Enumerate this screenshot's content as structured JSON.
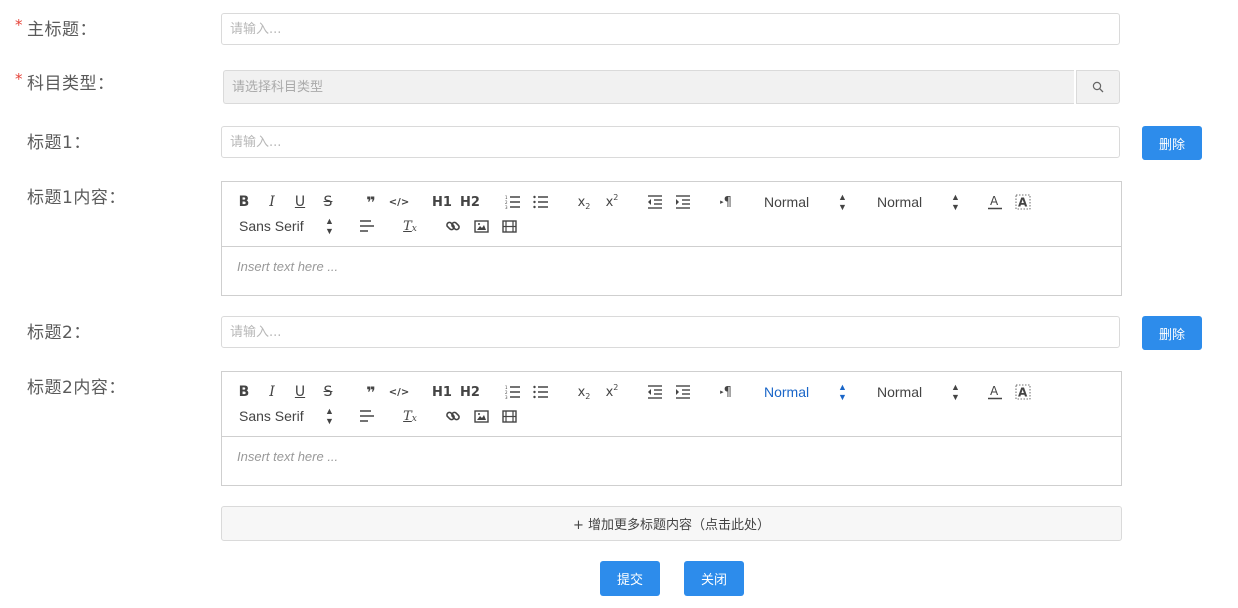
{
  "form": {
    "main_title": {
      "required_mark": "*",
      "label": "主标题：",
      "placeholder": "请输入..."
    },
    "subject_type": {
      "required_mark": "*",
      "label": "科目类型：",
      "placeholder": "请选择科目类型",
      "search_icon": "search-icon"
    },
    "sections": [
      {
        "title_label": "标题1：",
        "title_placeholder": "请输入...",
        "delete_label": "删除",
        "content_label": "标题1内容：",
        "editor": {
          "header_picker": "Normal",
          "size_picker": "Normal",
          "font_picker": "Sans Serif",
          "placeholder": "Insert text here ..."
        }
      },
      {
        "title_label": "标题2：",
        "title_placeholder": "请输入...",
        "delete_label": "删除",
        "content_label": "标题2内容：",
        "editor": {
          "header_picker": "Normal",
          "size_picker": "Normal",
          "font_picker": "Sans Serif",
          "placeholder": "Insert text here ..."
        }
      }
    ],
    "add_more_label": "+ 增加更多标题内容（点击此处）",
    "submit_label": "提交",
    "close_label": "关闭"
  },
  "toolbar_icons": {
    "bold": "B",
    "italic": "I",
    "underline": "U",
    "strike": "S",
    "blockquote": "❞",
    "code": "</>",
    "h1": "H1",
    "h2": "H2",
    "subscript": "x2",
    "superscript": "x2",
    "rtl": "¶",
    "clean": "Tx"
  },
  "colors": {
    "primary": "#2d8ceb",
    "required": "#e5443a",
    "active_picker": "#1a66c8"
  }
}
